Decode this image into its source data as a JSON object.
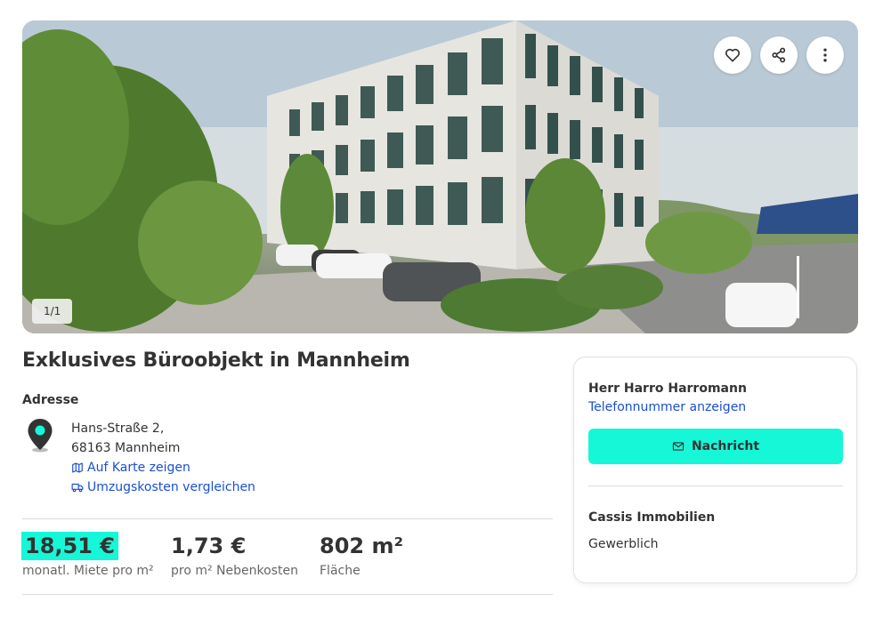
{
  "gallery": {
    "counter": "1/1",
    "actions": [
      "heart-icon",
      "share-icon",
      "more-vertical-icon"
    ]
  },
  "listing": {
    "title": "Exklusives Büroobjekt in Mannheim",
    "address_label": "Adresse",
    "street": "Hans-Straße 2,",
    "city": "68163 Mannheim",
    "map_link": "Auf Karte zeigen",
    "moving_link": "Umzugskosten vergleichen"
  },
  "facts": [
    {
      "value": "18,51 €",
      "label": "monatl. Miete pro m²"
    },
    {
      "value": "1,73 €",
      "label": "pro m² Nebenkosten"
    },
    {
      "value": "802 m²",
      "label": "Fläche"
    }
  ],
  "contact": {
    "name": "Herr Harro Harromann",
    "phone_link": "Telefonnummer anzeigen",
    "message_button": "Nachricht",
    "company": "Cassis Immobilien",
    "company_type": "Gewerblich"
  },
  "colors": {
    "accent": "#16f7d8",
    "link": "#1a4fcf",
    "text": "#333333"
  }
}
